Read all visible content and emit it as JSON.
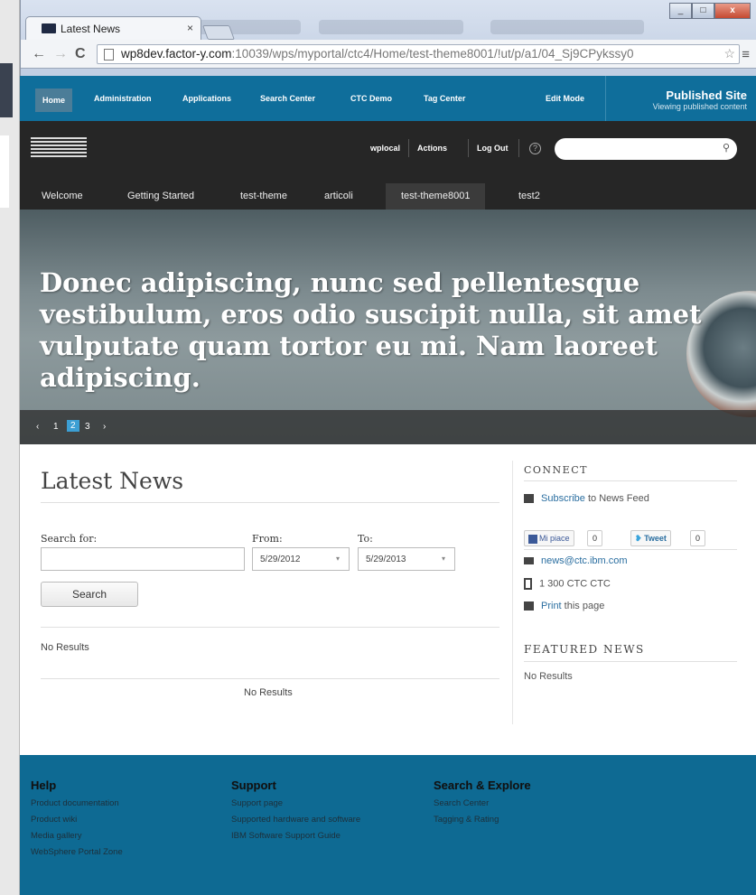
{
  "browser": {
    "tab_title": "Latest News",
    "tab_close": "×",
    "url_host": "wp8dev.factor-y.com",
    "url_path": ":10039/wps/myportal/ctc4/Home/test-theme8001/!ut/p/a1/04_Sj9CPykssy0"
  },
  "admin_bar": {
    "items": [
      "Home",
      "Administration",
      "Applications",
      "Search Center",
      "CTC Demo",
      "Tag Center",
      "Edit Mode"
    ],
    "published_title": "Published Site",
    "published_sub": "Viewing published content"
  },
  "banner": {
    "logo": "IBM.",
    "user": "wplocal",
    "actions": "Actions",
    "logout": "Log Out",
    "help": "?",
    "search_icon": "⚲"
  },
  "top_nav": [
    "Welcome",
    "Getting Started",
    "test-theme",
    "articoli",
    "test-theme8001",
    "test2"
  ],
  "hero": {
    "text": "Donec adipiscing, nunc sed pellentesque vestibulum, eros odio suscipit nulla, sit amet vulputate quam tortor eu mi. Nam laoreet adipiscing.",
    "prev": "‹",
    "next": "›",
    "pages": [
      "1",
      "2",
      "3"
    ],
    "current_page": "2"
  },
  "news": {
    "title": "Latest News",
    "search_for_label": "Search for:",
    "search_value": "",
    "from_label": "From:",
    "from_value": "5/29/2012",
    "to_label": "To:",
    "to_value": "5/29/2013",
    "search_button": "Search",
    "no_results_1": "No Results",
    "no_results_2": "No Results"
  },
  "connect": {
    "title": "CONNECT",
    "subscribe_link": "Subscribe",
    "subscribe_rest": " to News Feed",
    "like_label": "Mi piace",
    "like_count": "0",
    "tweet_label": "Tweet",
    "tweet_count": "0",
    "email": "news@ctc.ibm.com",
    "phone": "1 300 CTC CTC",
    "print_link": "Print",
    "print_rest": " this page"
  },
  "featured": {
    "title": "FEATURED NEWS",
    "no_results": "No Results"
  },
  "footer": {
    "columns": [
      {
        "title": "Help",
        "links": [
          "Product documentation",
          "Product wiki",
          "Media gallery",
          "WebSphere Portal Zone"
        ]
      },
      {
        "title": "Support",
        "links": [
          "Support page",
          "Supported hardware and software",
          "IBM Software Support Guide"
        ]
      },
      {
        "title": "Search & Explore",
        "links": [
          "Search Center",
          "Tagging & Rating"
        ]
      }
    ]
  },
  "colors": {
    "admin_blue": "#0f6e9b",
    "banner_dark": "#262626",
    "link_blue": "#2a6ea0",
    "pager_active": "#3c9fd4"
  }
}
